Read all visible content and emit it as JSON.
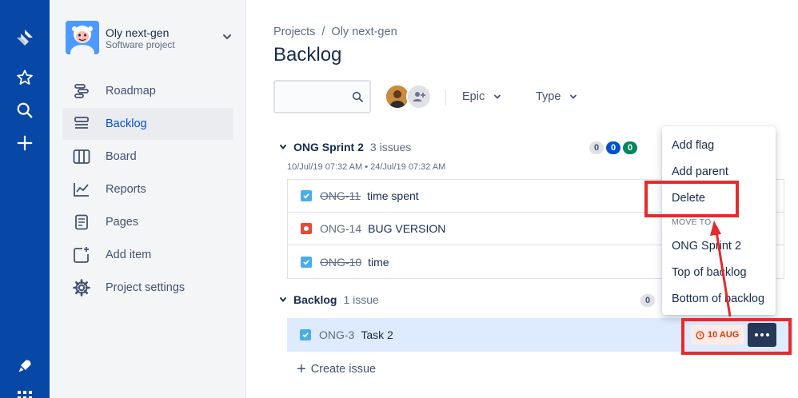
{
  "global_nav": {
    "icons": [
      "jira-logo-icon",
      "star-icon",
      "search-icon",
      "plus-icon",
      "rocket-icon",
      "app-switcher-icon"
    ]
  },
  "project": {
    "name": "Oly next-gen",
    "type": "Software project"
  },
  "sidebar": {
    "items": [
      {
        "label": "Roadmap",
        "icon": "roadmap-icon"
      },
      {
        "label": "Backlog",
        "icon": "backlog-icon",
        "active": true
      },
      {
        "label": "Board",
        "icon": "board-icon"
      },
      {
        "label": "Reports",
        "icon": "reports-icon"
      },
      {
        "label": "Pages",
        "icon": "pages-icon"
      },
      {
        "label": "Add item",
        "icon": "add-item-icon"
      },
      {
        "label": "Project settings",
        "icon": "gear-icon"
      }
    ]
  },
  "breadcrumb": {
    "root": "Projects",
    "separator": "/",
    "project": "Oly next-gen"
  },
  "page": {
    "title": "Backlog"
  },
  "search": {
    "value": "",
    "placeholder": ""
  },
  "filters": {
    "epic": "Epic",
    "type": "Type"
  },
  "sprint": {
    "name": "ONG Sprint 2",
    "count": "3 issues",
    "dates": "10/Jul/19 07:32 AM • 24/Jul/19 07:32 AM",
    "badges": [
      "0",
      "0",
      "0"
    ],
    "issues": [
      {
        "key": "ONG-11",
        "summary": "time spent",
        "type": "story",
        "done": true
      },
      {
        "key": "ONG-14",
        "summary": "BUG VERSION",
        "type": "bug",
        "done": false
      },
      {
        "key": "ONG-10",
        "summary": "time",
        "type": "story",
        "done": true
      }
    ]
  },
  "backlog": {
    "name": "Backlog",
    "count": "1 issue",
    "badge": "0",
    "issue": {
      "key": "ONG-3",
      "summary": "Task 2",
      "due": "10 AUG"
    },
    "create_label": "Create issue"
  },
  "context_menu": {
    "add_flag": "Add flag",
    "add_parent": "Add parent",
    "delete": "Delete",
    "move_to_header": "MOVE TO",
    "move_sprint": "ONG Sprint 2",
    "move_top": "Top of backlog",
    "move_bottom": "Bottom of backlog"
  },
  "colors": {
    "nav_bg": "#0747a6",
    "accent": "#0052cc",
    "highlight": "#e52b2b",
    "selected_row": "#deebff",
    "due_red": "#de350b"
  }
}
